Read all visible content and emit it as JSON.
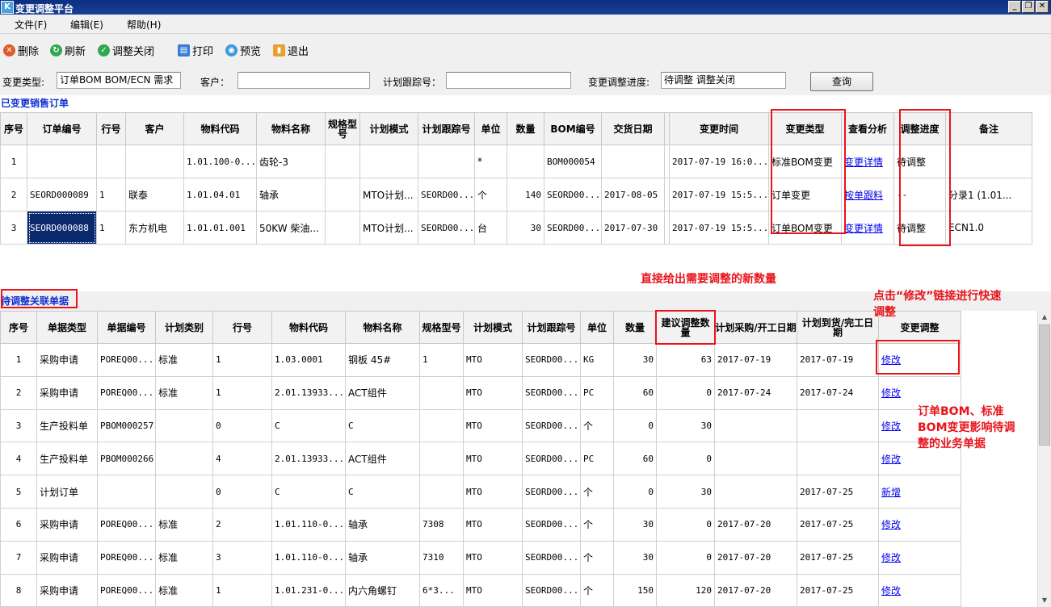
{
  "window": {
    "title": "变更调整平台",
    "app_icon": "K",
    "controls": [
      "_",
      "❐",
      "✕"
    ]
  },
  "menu": [
    "文件(F)",
    "编辑(E)",
    "帮助(H)"
  ],
  "toolbar": [
    {
      "label": "删除",
      "icon": "delete-icon",
      "color": "#e05a2a",
      "glyph": "✕"
    },
    {
      "label": "刷新",
      "icon": "refresh-icon",
      "color": "#2fa84f",
      "glyph": "↻"
    },
    {
      "label": "调整关闭",
      "icon": "check-icon",
      "color": "#2fa84f",
      "glyph": "✓"
    },
    {
      "label": "打印",
      "icon": "print-icon",
      "color": "#3a7bd5",
      "glyph": "▤"
    },
    {
      "label": "预览",
      "icon": "preview-icon",
      "color": "#3a9ad9",
      "glyph": "◉"
    },
    {
      "label": "退出",
      "icon": "exit-icon",
      "color": "#e8a030",
      "glyph": "▮"
    }
  ],
  "filters": {
    "change_type_label": "变更类型:",
    "change_type_value": "订单BOM BOM/ECN 需求",
    "customer_label": "客户：",
    "customer_value": "",
    "tracking_label": "计划跟踪号：",
    "tracking_value": "",
    "progress_label": "变更调整进度:",
    "progress_value": "待调整 调整关闭",
    "query_label": "查询"
  },
  "section1": {
    "title": "已变更销售订单",
    "headers": [
      "序号",
      "订单编号",
      "行号",
      "客户",
      "物料代码",
      "物料名称",
      "规格型号",
      "计划模式",
      "计划跟踪号",
      "单位",
      "数量",
      "BOM编号",
      "交货日期",
      "",
      "变更时间",
      "变更类型",
      "查看分析",
      "调整进度",
      "备注"
    ],
    "rows": [
      [
        "1",
        "",
        "",
        "",
        "1.01.100-0...",
        "齿轮-3",
        "",
        "",
        "",
        "*",
        "",
        "BOM000054",
        "",
        "",
        "2017-07-19 16:0...",
        "标准BOM变更",
        "变更详情",
        "待调整",
        ""
      ],
      [
        "2",
        "SEORD000089",
        "1",
        "联泰",
        "1.01.04.01",
        "轴承",
        "",
        "MTO计划...",
        "SEORD00...",
        "个",
        "140",
        "SEORD00...",
        "2017-08-05",
        "",
        "2017-07-19 15:5...",
        "订单变更",
        "按单跟料",
        "--",
        "分录1 (1.01..."
      ],
      [
        "3",
        "SEORD000088",
        "1",
        "东方机电",
        "1.01.01.001",
        "50KW 柴油...",
        "",
        "MTO计划...",
        "SEORD00...",
        "台",
        "30",
        "SEORD00...",
        "2017-07-30",
        "",
        "2017-07-19 15:5...",
        "订单BOM变更",
        "变更详情",
        "待调整",
        "ECN1.0"
      ]
    ]
  },
  "section2": {
    "title": "待调整关联单据",
    "headers": [
      "序号",
      "单据类型",
      "单据编号",
      "计划类别",
      "行号",
      "物料代码",
      "物料名称",
      "规格型号",
      "计划模式",
      "计划跟踪号",
      "单位",
      "数量",
      "建议调整数量",
      "计划采购/开工日期",
      "计划到货/完工日期",
      "变更调整"
    ],
    "rows": [
      [
        "1",
        "采购申请",
        "POREQ00...",
        "标准",
        "1",
        "1.03.0001",
        "钢板 45#",
        "1",
        "MTO",
        "SEORD00...",
        "KG",
        "30",
        "63",
        "2017-07-19",
        "2017-07-19",
        "修改"
      ],
      [
        "2",
        "采购申请",
        "POREQ00...",
        "标准",
        "1",
        "2.01.13933...",
        "ACT组件",
        "",
        "MTO",
        "SEORD00...",
        "PC",
        "60",
        "0",
        "2017-07-24",
        "2017-07-24",
        "修改"
      ],
      [
        "3",
        "生产投料单",
        "PBOM000257",
        "",
        "0",
        "C",
        "C",
        "",
        "MTO",
        "SEORD00...",
        "个",
        "0",
        "30",
        "",
        "",
        "修改"
      ],
      [
        "4",
        "生产投料单",
        "PBOM000266",
        "",
        "4",
        "2.01.13933...",
        "ACT组件",
        "",
        "MTO",
        "SEORD00...",
        "PC",
        "60",
        "0",
        "",
        "",
        "修改"
      ],
      [
        "5",
        "计划订单",
        "",
        "",
        "0",
        "C",
        "C",
        "",
        "MTO",
        "SEORD00...",
        "个",
        "0",
        "30",
        "",
        "2017-07-25",
        "新增"
      ],
      [
        "6",
        "采购申请",
        "POREQ00...",
        "标准",
        "2",
        "1.01.110-0...",
        "轴承",
        "7308",
        "MTO",
        "SEORD00...",
        "个",
        "30",
        "0",
        "2017-07-20",
        "2017-07-25",
        "修改"
      ],
      [
        "7",
        "采购申请",
        "POREQ00...",
        "标准",
        "3",
        "1.01.110-0...",
        "轴承",
        "7310",
        "MTO",
        "SEORD00...",
        "个",
        "30",
        "0",
        "2017-07-20",
        "2017-07-25",
        "修改"
      ],
      [
        "8",
        "采购申请",
        "POREQ00...",
        "标准",
        "1",
        "1.01.231-0...",
        "内六角螺钉",
        "6*3...",
        "MTO",
        "SEORD00...",
        "个",
        "150",
        "120",
        "2017-07-20",
        "2017-07-25",
        "修改"
      ]
    ]
  },
  "annotations": {
    "a1": "直接给出需要调整的新数量",
    "a2": "点击“修改”链接进行快速调整",
    "a3": "订单BOM、标准BOM变更影响待调整的业务单据"
  },
  "colors": {
    "highlight": "#e8141b",
    "link": "#0000ee",
    "section_title": "#1030d0",
    "titlebar": "#0d2f80"
  }
}
